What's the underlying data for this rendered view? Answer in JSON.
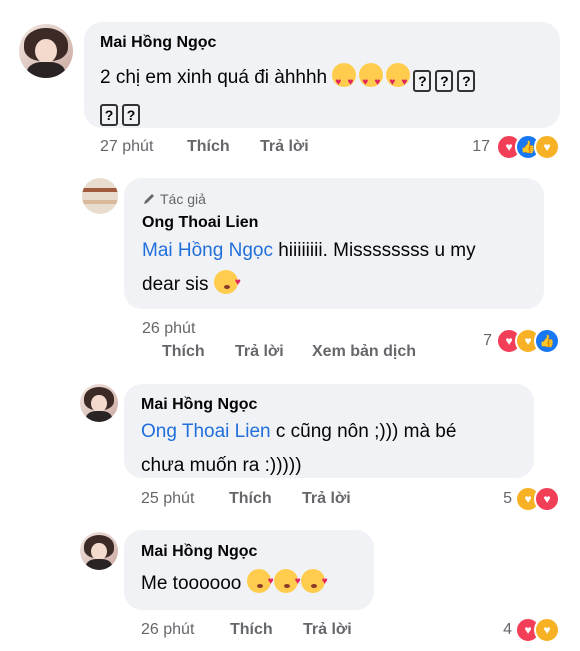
{
  "comments": [
    {
      "author": "Mai Hồng Ngọc",
      "text_line1": "2 chị em xinh quá đi àhhhh",
      "emoji_icons": [
        "heart-eyes-emoji",
        "heart-eyes-emoji",
        "heart-eyes-emoji"
      ],
      "missing_glyphs": [
        "?",
        "?",
        "?",
        "?",
        "?"
      ],
      "time": "27 phút",
      "like": "Thích",
      "reply": "Trả lời",
      "reaction_count": "17",
      "reactions": [
        "love",
        "like",
        "care"
      ]
    },
    {
      "badge": "Tác giả",
      "author": "Ong Thoai Lien",
      "mention": "Mai Hồng Ngọc",
      "text_line1_rest": " hiiiiiiii. Missssssss u my",
      "text_line2": "dear sis",
      "emoji_icons": [
        "kiss-emoji"
      ],
      "time": "26 phút",
      "like": "Thích",
      "reply": "Trả lời",
      "translate": "Xem bản dịch",
      "reaction_count": "7",
      "reactions": [
        "love",
        "care",
        "like"
      ]
    },
    {
      "author": "Mai Hồng Ngọc",
      "mention": "Ong Thoai Lien",
      "text_line1_rest": " c cũng nôn ;))) mà bé",
      "text_line2": "chưa muốn ra :)))))",
      "time": "25 phút",
      "like": "Thích",
      "reply": "Trả lời",
      "reaction_count": "5",
      "reactions": [
        "care",
        "love"
      ]
    },
    {
      "author": "Mai Hồng Ngọc",
      "text_line1": "Me toooooo",
      "emoji_icons": [
        "kiss-emoji",
        "kiss-emoji",
        "kiss-emoji"
      ],
      "time": "26 phút",
      "like": "Thích",
      "reply": "Trả lời",
      "reaction_count": "4",
      "reactions": [
        "love",
        "care"
      ]
    }
  ],
  "colors": {
    "bubble": "#f0f2f5",
    "mention": "#216fdb",
    "meta": "#65676b",
    "love": "#f33e58",
    "like": "#1877f2",
    "care": "#f7b125"
  }
}
